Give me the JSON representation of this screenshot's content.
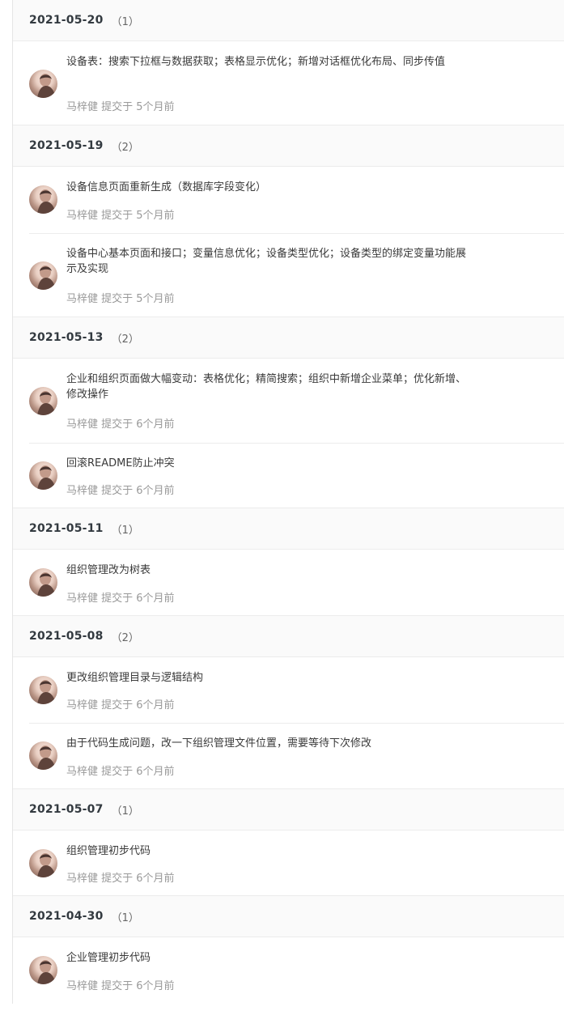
{
  "groups": [
    {
      "date": "2021-05-20",
      "count": "（1）",
      "commits": [
        {
          "message": "设备表：搜索下拉框与数据获取；表格显示优化；新增对话框优化布局、同步传值",
          "meta": "马梓健 提交于 5个月前"
        }
      ]
    },
    {
      "date": "2021-05-19",
      "count": "（2）",
      "commits": [
        {
          "message": "设备信息页面重新生成（数据库字段变化）",
          "meta": "马梓健 提交于 5个月前"
        },
        {
          "message": "设备中心基本页面和接口；变量信息优化；设备类型优化；设备类型的绑定变量功能展示及实现",
          "meta": "马梓健 提交于 5个月前"
        }
      ]
    },
    {
      "date": "2021-05-13",
      "count": "（2）",
      "commits": [
        {
          "message": "企业和组织页面做大幅变动：表格优化；精简搜索；组织中新增企业菜单；优化新增、修改操作",
          "meta": "马梓健 提交于 6个月前"
        },
        {
          "message": "回滚README防止冲突",
          "meta": "马梓健 提交于 6个月前"
        }
      ]
    },
    {
      "date": "2021-05-11",
      "count": "（1）",
      "commits": [
        {
          "message": "组织管理改为树表",
          "meta": "马梓健 提交于 6个月前"
        }
      ]
    },
    {
      "date": "2021-05-08",
      "count": "（2）",
      "commits": [
        {
          "message": "更改组织管理目录与逻辑结构",
          "meta": "马梓健 提交于 6个月前"
        },
        {
          "message": "由于代码生成问题，改一下组织管理文件位置，需要等待下次修改",
          "meta": "马梓健 提交于 6个月前"
        }
      ]
    },
    {
      "date": "2021-05-07",
      "count": "（1）",
      "commits": [
        {
          "message": "组织管理初步代码",
          "meta": "马梓健 提交于 6个月前"
        }
      ]
    },
    {
      "date": "2021-04-30",
      "count": "（1）",
      "commits": [
        {
          "message": "企业管理初步代码",
          "meta": "马梓健 提交于 6个月前"
        }
      ]
    }
  ]
}
